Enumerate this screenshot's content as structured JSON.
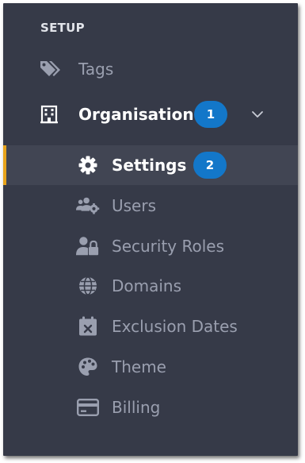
{
  "colors": {
    "panel_bg": "#363a48",
    "active_row_bg": "#414553",
    "accent": "#e8a41b",
    "badge_bg": "#1377c9",
    "dim_text": "#9a9faf",
    "bright_text": "#ffffff"
  },
  "sidebar": {
    "section_title": "SETUP",
    "items": [
      {
        "label": "Tags",
        "icon": "tags-icon"
      },
      {
        "label": "Organisation",
        "icon": "building-icon",
        "badge": "1",
        "expanded": true
      }
    ],
    "sub_items": [
      {
        "label": "Settings",
        "icon": "gear-icon",
        "badge": "2",
        "active": true
      },
      {
        "label": "Users",
        "icon": "users-gear-icon"
      },
      {
        "label": "Security Roles",
        "icon": "user-lock-icon"
      },
      {
        "label": "Domains",
        "icon": "globe-icon"
      },
      {
        "label": "Exclusion Dates",
        "icon": "calendar-times-icon"
      },
      {
        "label": "Theme",
        "icon": "palette-icon"
      },
      {
        "label": "Billing",
        "icon": "credit-card-icon"
      }
    ]
  }
}
